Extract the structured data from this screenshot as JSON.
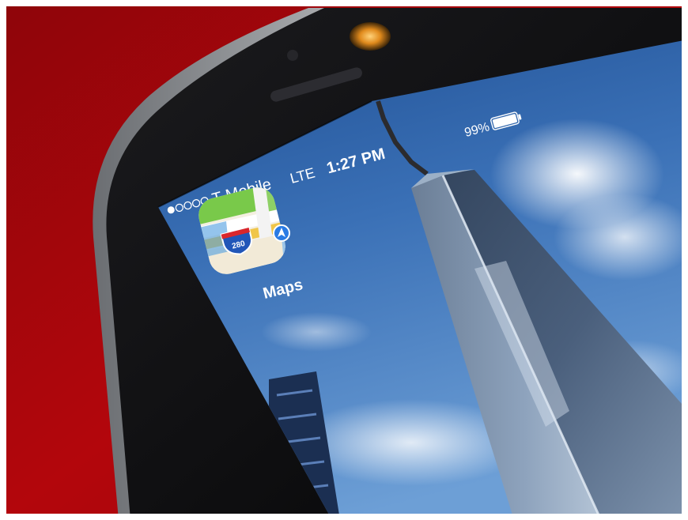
{
  "status_bar": {
    "carrier": "T-Mobile",
    "network": "LTE",
    "time": "1:27 PM",
    "battery": "99%",
    "signal_filled": 1,
    "signal_total": 5,
    "battery_level": 0.99
  },
  "apps": [
    {
      "label": "Maps",
      "icon": "maps-icon",
      "road_shield": "280"
    }
  ],
  "colors": {
    "tablecloth": "#b3060c",
    "phone_body": "#101012",
    "sky": "#3f74b9",
    "tower_glass": "#5c6f85",
    "frame_edge": "#ffffff"
  }
}
